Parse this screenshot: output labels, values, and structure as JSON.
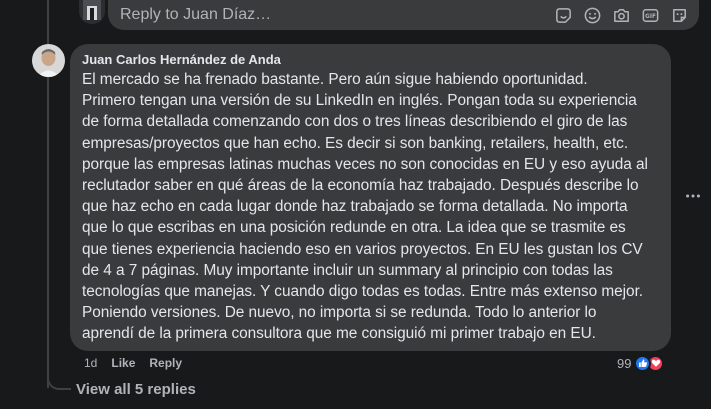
{
  "reply": {
    "placeholder": "Reply to Juan Díaz…",
    "icons": [
      "sticker-icon",
      "emoji-icon",
      "camera-icon",
      "gif-icon",
      "sticker-alt-icon"
    ]
  },
  "comment": {
    "author": "Juan Carlos Hernández de Anda",
    "lines": [
      "El mercado se ha frenado bastante. Pero aún sigue habiendo oportunidad.",
      "Primero tengan una versión de su LinkedIn en inglés. Pongan toda su experiencia",
      "de forma detallada comenzando con dos o tres líneas describiendo el giro de las",
      "empresas/proyectos que han echo. Es decir si son banking, retailers, health, etc.",
      "porque las empresas latinas muchas veces no son conocidas en EU y eso ayuda al",
      "reclutador saber en qué áreas de la economía haz trabajado. Después describe lo",
      "que haz echo en cada lugar donde haz trabajado se forma detallada. No importa",
      "que lo que escribas en una posición redunde en otra. La idea que se trasmite es",
      "que tienes experiencia haciendo eso en varios proyectos. En EU les gustan los CV",
      "de 4 a 7 páginas. Muy importante incluir un summary al principio con todas las",
      "tecnologías que manejas. Y cuando digo todas es todas. Entre más extenso mejor.",
      "Poniendo versiones. De nuevo, no importa si se redunda. Todo lo anterior lo",
      "aprendí de la primera consultora que me consiguió mi primer trabajo en EU."
    ],
    "time": "1d",
    "like_label": "Like",
    "reply_label": "Reply",
    "reaction_count": "99",
    "reactions": [
      "like-icon",
      "love-icon"
    ]
  },
  "view_replies": "View all 5 replies",
  "colors": {
    "background": "#18191a",
    "bubble": "#3a3b3c",
    "text": "#e4e6eb",
    "muted": "#b0b3b8",
    "like": "#2078f4",
    "love": "#f33e58"
  }
}
